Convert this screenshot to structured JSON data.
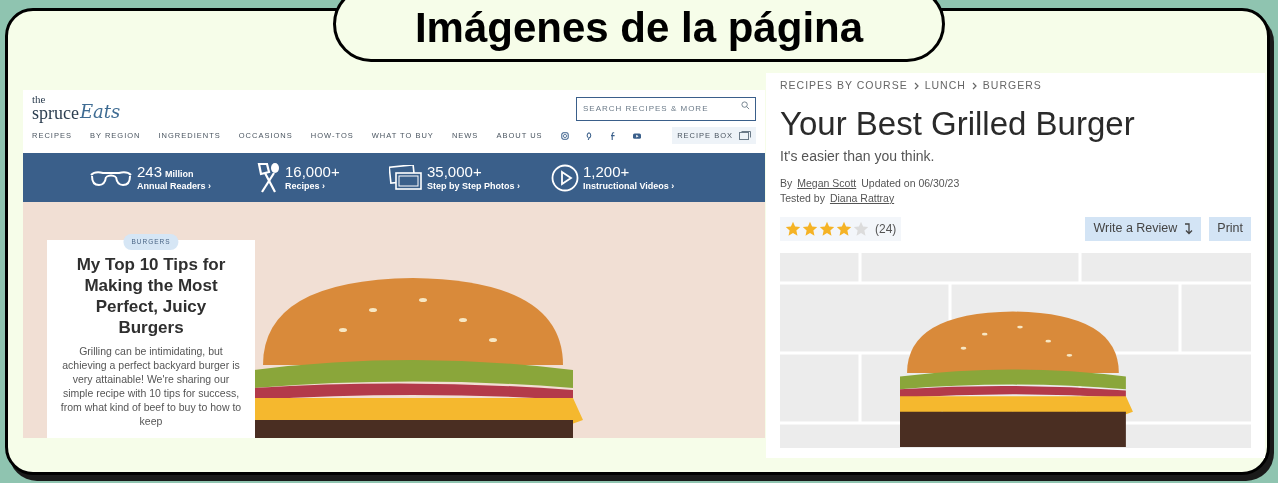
{
  "slide_title": "Imágenes de la página",
  "left_page": {
    "logo": {
      "small": "the",
      "main": "spruce",
      "script": "Eats"
    },
    "search": {
      "placeholder": "SEARCH RECIPES & MORE"
    },
    "nav": [
      "RECIPES",
      "BY REGION",
      "INGREDIENTS",
      "OCCASIONS",
      "HOW-TOS",
      "WHAT TO BUY",
      "NEWS",
      "ABOUT US"
    ],
    "recipe_box": "RECIPE BOX",
    "stats": [
      {
        "kind": "readers",
        "value": "243",
        "unit": "Million",
        "label": "Annual Readers ›"
      },
      {
        "kind": "recipes",
        "value": "16,000+",
        "label": "Recipes ›"
      },
      {
        "kind": "photos",
        "value": "35,000+",
        "label": "Step by Step Photos ›"
      },
      {
        "kind": "videos",
        "value": "1,200+",
        "label": "Instructional Videos ›"
      }
    ],
    "article": {
      "tag": "BURGERS",
      "title": "My Top 10 Tips for Making the Most Perfect, Juicy Burgers",
      "excerpt": "Grilling can be intimidating, but achieving a perfect backyard burger is very attainable! We're sharing our simple recipe with 10 tips for success, from what kind of beef to buy to how to keep"
    }
  },
  "right_page": {
    "breadcrumb": [
      "RECIPES BY COURSE",
      "LUNCH",
      "BURGERS"
    ],
    "title": "Your Best Grilled Burger",
    "subtitle": "It's easier than you think.",
    "byline": {
      "by": "By",
      "author": "Megan Scott",
      "updated": "Updated on 06/30/23",
      "tested_by": "Tested by",
      "tester": "Diana Rattray"
    },
    "rating": {
      "stars": 4,
      "count": "(24)"
    },
    "buttons": [
      {
        "kind": "review",
        "label": "Write a Review"
      },
      {
        "kind": "print",
        "label": "Print"
      }
    ]
  }
}
